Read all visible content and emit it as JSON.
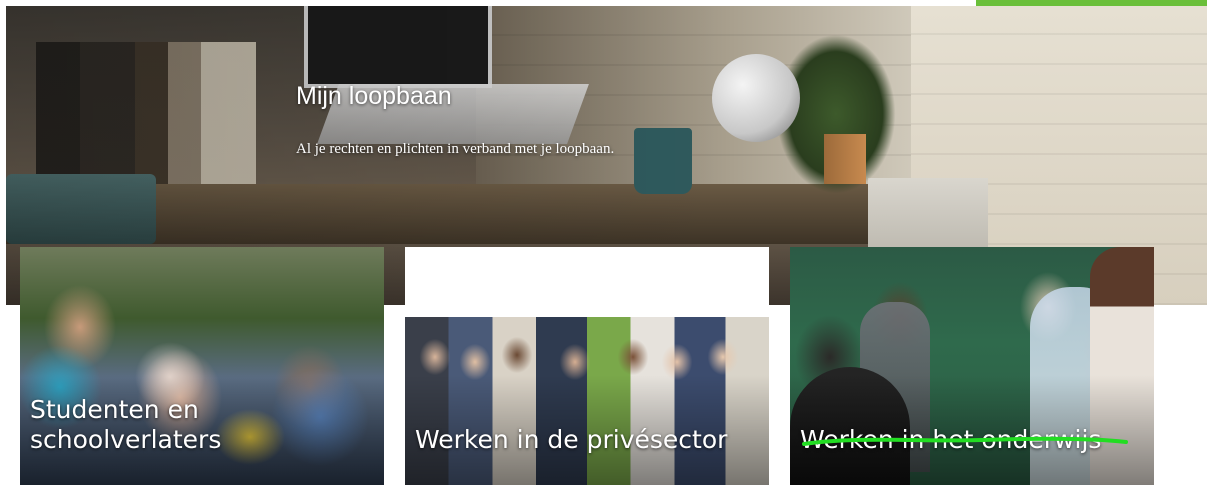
{
  "hero": {
    "title": "Mijn loopbaan",
    "subtitle": "Al je rechten en plichten in verband met je loopbaan."
  },
  "cards": [
    {
      "title": "Studenten en schoolverlaters",
      "image": "students-photo"
    },
    {
      "title": "Werken in de privésector",
      "image": "workers-photo"
    },
    {
      "title": "Werken in het onderwijs",
      "image": "classroom-photo"
    }
  ],
  "colors": {
    "accent": "#6abf3a",
    "highlight": "#22dd22",
    "text": "#ffffff"
  }
}
